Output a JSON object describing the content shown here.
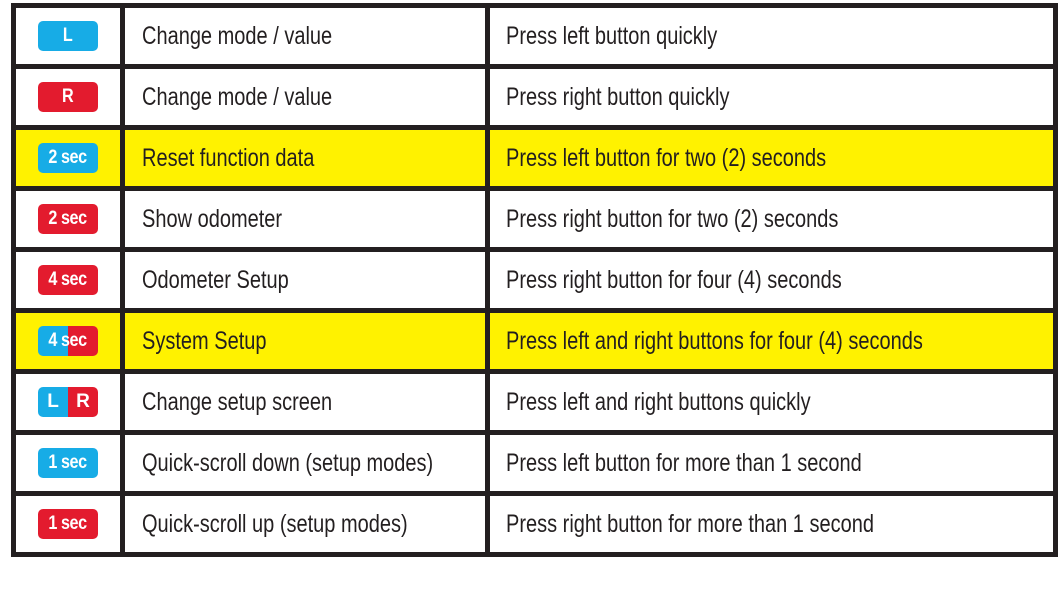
{
  "colors": {
    "left": "#17ace6",
    "right": "#e31b2e",
    "highlight": "#fff200"
  },
  "rows": [
    {
      "badge": "L",
      "button": "left",
      "action": "Change mode / value",
      "instruction": "Press left button quickly",
      "highlight": false
    },
    {
      "badge": "R",
      "button": "right",
      "action": "Change mode / value",
      "instruction": "Press right button quickly",
      "highlight": false
    },
    {
      "badge": "2 sec",
      "button": "left",
      "action": "Reset function data",
      "instruction": "Press left button for two (2) seconds",
      "highlight": true
    },
    {
      "badge": "2 sec",
      "button": "right",
      "action": "Show odometer",
      "instruction": "Press right button for two (2) seconds",
      "highlight": false
    },
    {
      "badge": "4 sec",
      "button": "right",
      "action": "Odometer Setup",
      "instruction": "Press right button for four (4) seconds",
      "highlight": false
    },
    {
      "badge": "4 sec",
      "button": "both",
      "action": "System Setup",
      "instruction": "Press left and right buttons for four (4) seconds",
      "highlight": true
    },
    {
      "badge_left": "L",
      "badge_right": "R",
      "button": "both-split",
      "action": "Change setup screen",
      "instruction": "Press left and right buttons quickly",
      "highlight": false
    },
    {
      "badge": "1 sec",
      "button": "left",
      "action": "Quick-scroll down (setup modes)",
      "instruction": "Press left button for more than 1 second",
      "highlight": false
    },
    {
      "badge": "1 sec",
      "button": "right",
      "action": "Quick-scroll up (setup modes)",
      "instruction": "Press right button for more than 1 second",
      "highlight": false
    }
  ]
}
